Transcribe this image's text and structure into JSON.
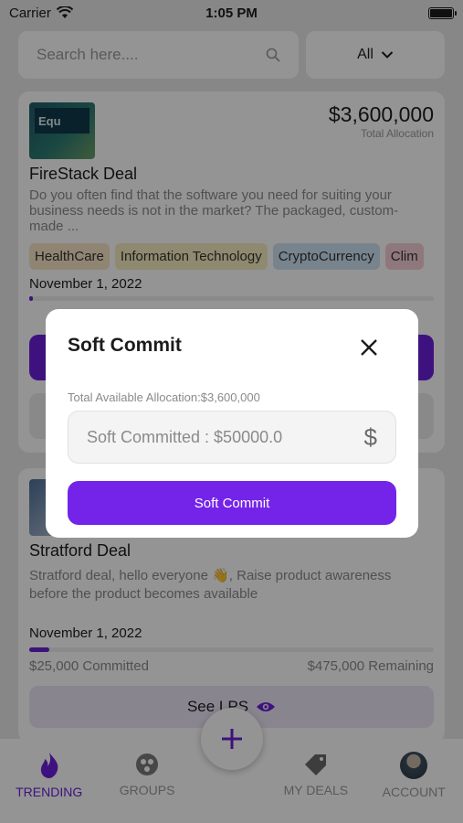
{
  "status": {
    "carrier": "Carrier",
    "time": "1:05 PM"
  },
  "search": {
    "placeholder": "Search here....",
    "filter": "All"
  },
  "cards": [
    {
      "title": "FireStack Deal",
      "amount": "$3,600,000",
      "amount_label": "Total Allocation",
      "thumb_text": "Equ",
      "description": "Do you often find that the software you need for suiting your business needs is not in the market? The packaged, custom-made ...",
      "tags": [
        {
          "label": "HealthCare",
          "color": "#f8e5c4"
        },
        {
          "label": "Information Technology",
          "color": "#f6ecc0"
        },
        {
          "label": "CryptoCurrency",
          "color": "#cde3f4"
        },
        {
          "label": "Clim",
          "color": "#f7cfd6"
        }
      ],
      "date": "November 1, 2022",
      "progress": 0.01
    },
    {
      "title": "Stratford Deal",
      "description": "Stratford deal, hello everyone 👋, Raise product awareness before the product becomes available",
      "date": "November 1, 2022",
      "progress": 0.05,
      "committed": "$25,000 Committed",
      "remaining": "$475,000 Remaining",
      "see_lps": "See LPS"
    }
  ],
  "nav": {
    "trending": "TRENDING",
    "groups": "GROUPS",
    "my_deals": "MY DEALS",
    "account": "ACCOUNT"
  },
  "modal": {
    "title": "Soft Commit",
    "available_label": "Total Available Allocation:$3,600,000",
    "input_placeholder": "Soft Committed : $50000.0",
    "submit": "Soft Commit"
  },
  "colors": {
    "accent": "#7424e8",
    "overlay": "rgba(0,0,0,0.42)"
  }
}
